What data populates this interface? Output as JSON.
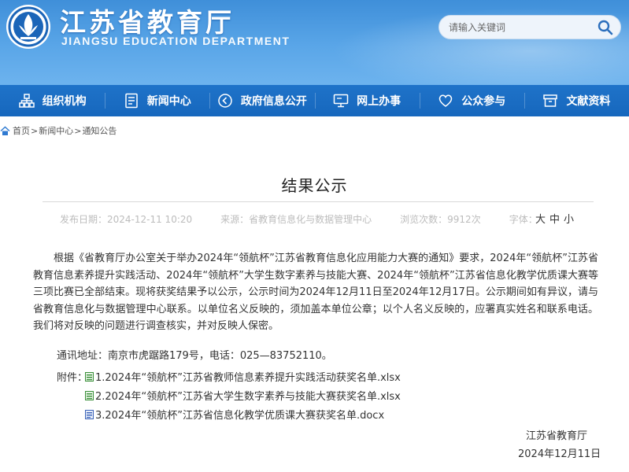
{
  "header": {
    "title": "江苏省教育厅",
    "subtitle": "JIANGSU EDUCATION DEPARTMENT",
    "search_placeholder": "请输入关键词"
  },
  "nav": {
    "items": [
      {
        "label": "组织机构",
        "icon": "org-chart-icon"
      },
      {
        "label": "新闻中心",
        "icon": "document-icon"
      },
      {
        "label": "政府信息公开",
        "icon": "info-circle-icon"
      },
      {
        "label": "网上办事",
        "icon": "monitor-icon"
      },
      {
        "label": "公众参与",
        "icon": "heart-icon"
      },
      {
        "label": "文献资料",
        "icon": "archive-icon"
      }
    ]
  },
  "breadcrumb": {
    "home": "首页",
    "news": "新闻中心",
    "notice": "通知公告",
    "separator": ">"
  },
  "article": {
    "title": "结果公示",
    "publish_date": "发布日期：2024-12-11 10:20",
    "source": "来源：省教育信息化与数据管理中心",
    "views": "浏览次数：9912次",
    "font_label": "字体：",
    "font_large": "大",
    "font_medium": "中",
    "font_small": "小",
    "body": "根据《省教育厅办公室关于举办2024年“领航杯”江苏省教育信息化应用能力大赛的通知》要求，2024年“领航杯”江苏省教育信息素养提升实践活动、2024年“领航杯”大学生数字素养与技能大赛、2024年“领航杯”江苏省信息化教学优质课大赛等三项比赛已全部结束。现将获奖结果予以公示，公示时间为2024年12月11日至2024年12月17日。公示期间如有异议，请与省教育信息化与数据管理中心联系。以单位名义反映的，须加盖本单位公章；以个人名义反映的，应署真实姓名和联系电话。我们将对反映的问题进行调查核实，并对反映人保密。",
    "contact": "通讯地址：南京市虎踞路179号，电话：025—83752110。",
    "attachments_label": "附件：",
    "attachments": [
      {
        "name": "1.2024年“领航杯”江苏省教师信息素养提升实践活动获奖名单.xlsx",
        "type": "xlsx"
      },
      {
        "name": "2.2024年“领航杯”江苏省大学生数字素养与技能大赛获奖名单.xlsx",
        "type": "xlsx"
      },
      {
        "name": "3.2024年“领航杯”江苏省信息化教学优质课大赛获奖名单.docx",
        "type": "docx"
      }
    ],
    "signature_org": "江苏省教育厅",
    "signature_date": "2024年12月11日"
  },
  "colors": {
    "header_blue": "#4a9ae0",
    "nav_blue": "#1a6bc1",
    "xlsx_green": "#3a8f3a",
    "docx_blue": "#3b63b8"
  }
}
